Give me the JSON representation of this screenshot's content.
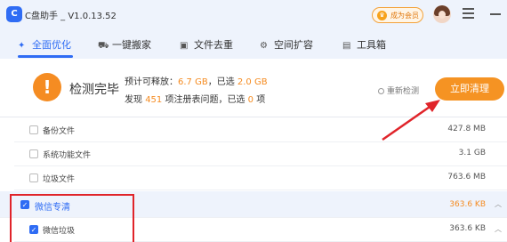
{
  "titlebar": {
    "logo_text": "C",
    "app_title": "C盘助手 _ V1.0.13.52",
    "vip_label": "成为会员",
    "vip_icon": "crown-icon"
  },
  "tabs": [
    {
      "label": "全面优化",
      "icon": "rocket-icon",
      "active": true
    },
    {
      "label": "一键搬家",
      "icon": "truck-icon",
      "active": false
    },
    {
      "label": "文件去重",
      "icon": "file-duplicate-icon",
      "active": false
    },
    {
      "label": "空间扩容",
      "icon": "expand-space-icon",
      "active": false
    },
    {
      "label": "工具箱",
      "icon": "toolbox-icon",
      "active": false
    }
  ],
  "result": {
    "status_title": "检测完毕",
    "line1_prefix": "预计可释放：",
    "line1_release": "6.7 GB",
    "line1_mid": "，已选",
    "line1_selected": "2.0 GB",
    "line2_prefix": "发现",
    "line2_count": "451",
    "line2_mid": "项注册表问题，已选",
    "line2_selected": "0",
    "line2_suffix": "项",
    "rescan_label": "重新检测",
    "clean_button": "立即清理"
  },
  "list": [
    {
      "name": "备份文件",
      "size": "427.8 MB",
      "checked": false,
      "group": false
    },
    {
      "name": "系统功能文件",
      "size": "3.1 GB",
      "checked": false,
      "group": false
    },
    {
      "name": "垃圾文件",
      "size": "763.6 MB",
      "checked": false,
      "group": false
    },
    {
      "name": "微信专清",
      "size": "363.6 KB",
      "checked": true,
      "group": true
    },
    {
      "name": "微信垃圾",
      "size": "363.6 KB",
      "checked": true,
      "group": false
    }
  ],
  "colors": {
    "accent": "#2f6cf4",
    "orange": "#f58c22",
    "annotation_red": "#e0242a"
  }
}
